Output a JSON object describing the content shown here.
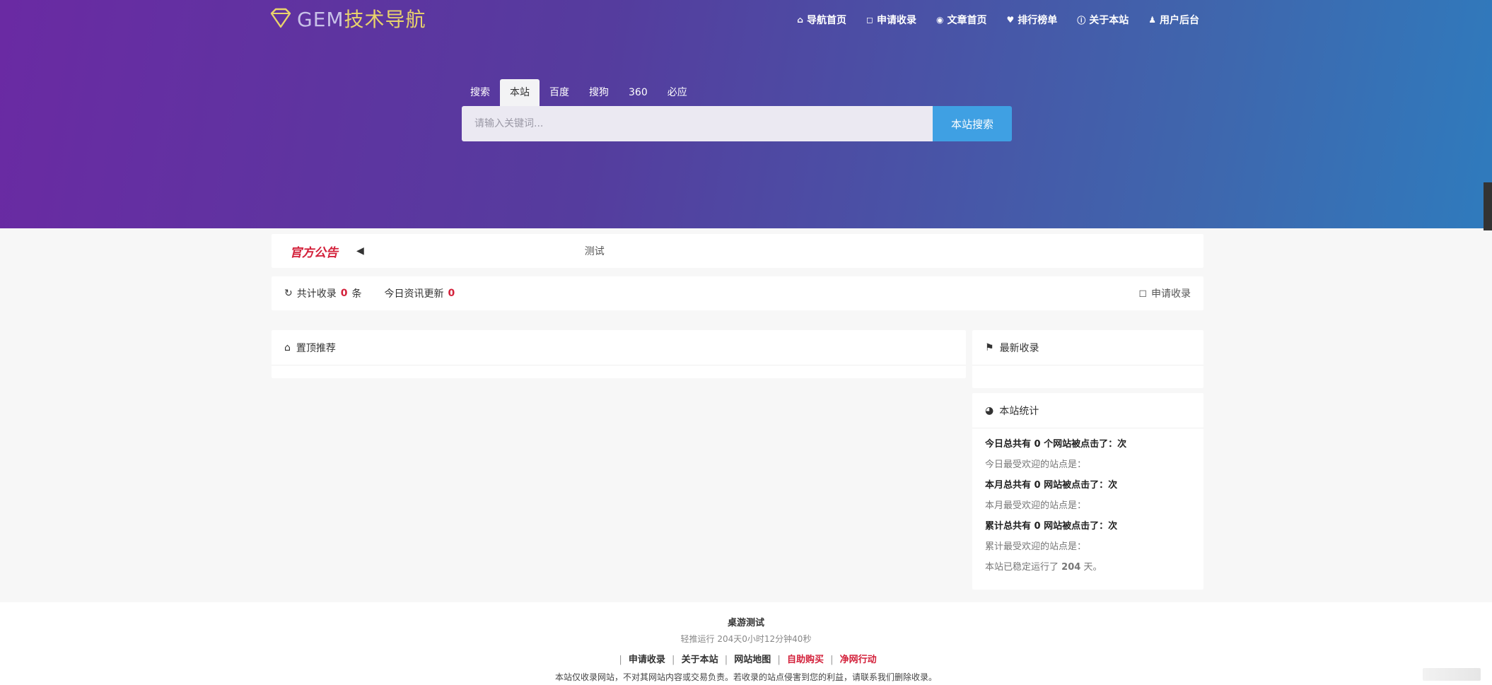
{
  "brand": {
    "logo_icon": "gem-icon",
    "name_prefix": "GEM",
    "name_suffix": "技术导航"
  },
  "topnav": [
    {
      "icon": "home-icon",
      "glyph": "⌂",
      "label": "导航首页"
    },
    {
      "icon": "apply-icon",
      "glyph": "◻",
      "label": "申请收录"
    },
    {
      "icon": "article-icon",
      "glyph": "◉",
      "label": "文章首页"
    },
    {
      "icon": "rank-icon",
      "glyph": "♥",
      "label": "排行榜单"
    },
    {
      "icon": "about-icon",
      "glyph": "ⓘ",
      "label": "关于本站"
    },
    {
      "icon": "user-icon",
      "glyph": "♟",
      "label": "用户后台"
    }
  ],
  "search": {
    "tabs": [
      "搜索",
      "本站",
      "百度",
      "搜狗",
      "360",
      "必应"
    ],
    "active_tab": "本站",
    "placeholder": "请输入关键词...",
    "button": "本站搜索"
  },
  "notice": {
    "title": "官方公告",
    "icon": "speaker-icon",
    "message": "测试"
  },
  "counts": {
    "total_label": "共计收录",
    "total_value": "0",
    "total_unit": "条",
    "today_label": "今日资讯更新",
    "today_value": "0",
    "apply_label": "申请收录"
  },
  "featured": {
    "icon": "home-icon",
    "title": "置顶推荐"
  },
  "latest": {
    "icon": "bookmark-icon",
    "title": "最新收录"
  },
  "site_stats": {
    "icon": "chart-icon",
    "title": "本站统计",
    "rows": [
      "今日总共有 0 个网站被点击了：次",
      "今日最受欢迎的站点是：",
      "本月总共有 0 网站被点击了：次",
      "本月最受欢迎的站点是：",
      "累计总共有 0 网站被点击了：次",
      "累计最受欢迎的站点是："
    ],
    "uptime_prefix": "本站已稳定运行了",
    "uptime_days": "204",
    "uptime_suffix": "天。"
  },
  "footer": {
    "site_name": "桌游测试",
    "uptime": "轻推运行 204天0小时12分钟40秒",
    "links": [
      {
        "label": "申请收录",
        "accent": false
      },
      {
        "label": "关于本站",
        "accent": false
      },
      {
        "label": "网站地图",
        "accent": false
      },
      {
        "label": "自助购买",
        "accent": true
      },
      {
        "label": "净网行动",
        "accent": true
      }
    ],
    "disclaimer": "本站仅收录网站，不对其网站内容或交易负责。若收录的站点侵害到您的利益，请联系我们删除收录。"
  },
  "colors": {
    "accent_red": "#d3203a",
    "accent_blue": "#3fa0e3",
    "hero_start": "#6a2aa3",
    "hero_end": "#2f7bbd"
  }
}
